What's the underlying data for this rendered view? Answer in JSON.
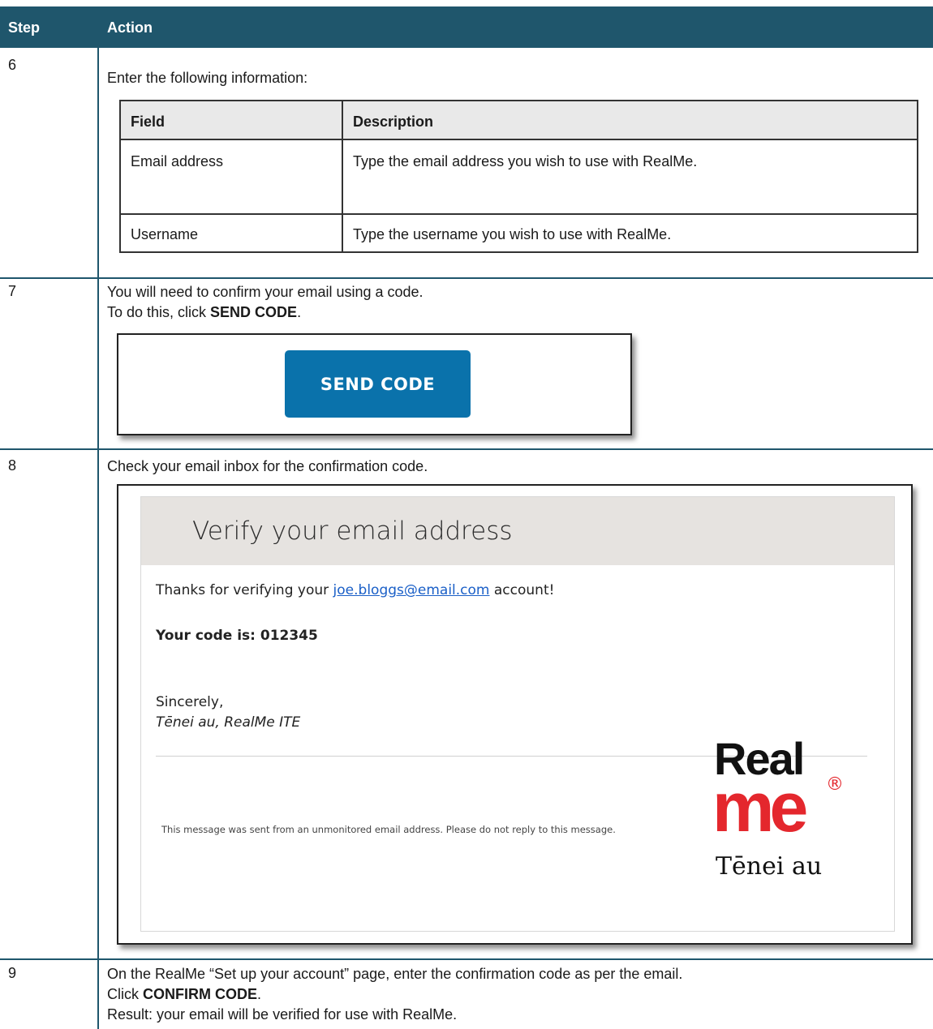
{
  "header": {
    "step_label": "Step",
    "action_label": "Action"
  },
  "step6": {
    "number": "6",
    "intro": "Enter the following information:",
    "table": {
      "headers": [
        "Field",
        "Description"
      ],
      "rows": [
        [
          "Email address",
          "Type the email address you wish to use with RealMe."
        ],
        [
          "Username",
          "Type the username you wish to use with RealMe."
        ]
      ]
    }
  },
  "step7": {
    "number": "7",
    "line1": "You will need to confirm your email using a code.",
    "line2_prefix": "To do this, click ",
    "line2_bold": "SEND CODE",
    "line2_suffix": ".",
    "button_label": "SEND CODE"
  },
  "step8": {
    "number": "8",
    "line1": "Check your email inbox for the confirmation code.",
    "email": {
      "title": "Verify your email address",
      "thanks_prefix": "Thanks for verifying your ",
      "email_link": "joe.bloggs@email.com",
      "thanks_suffix": " account!",
      "code_text": "Your code is: 012345",
      "sincerely": "Sincerely,",
      "signature": "Tēnei au, RealMe ITE",
      "footer": "This message was sent from an unmonitored email address. Please do not reply to this message.",
      "logo": {
        "real": "Real",
        "me": "me",
        "reg": "®",
        "tenei": "Tēnei au"
      }
    }
  },
  "step9": {
    "number": "9",
    "line1": "On the RealMe “Set up your account” page, enter the confirmation code as per the email.",
    "line2_prefix": "Click ",
    "line2_bold": "CONFIRM CODE",
    "line2_suffix": ".",
    "line3": "Result: your email will be verified for use with RealMe."
  },
  "colors": {
    "header": "#1f566c",
    "button": "#0a72ab",
    "logo_red": "#e4272d",
    "link": "#1a5fc7"
  }
}
